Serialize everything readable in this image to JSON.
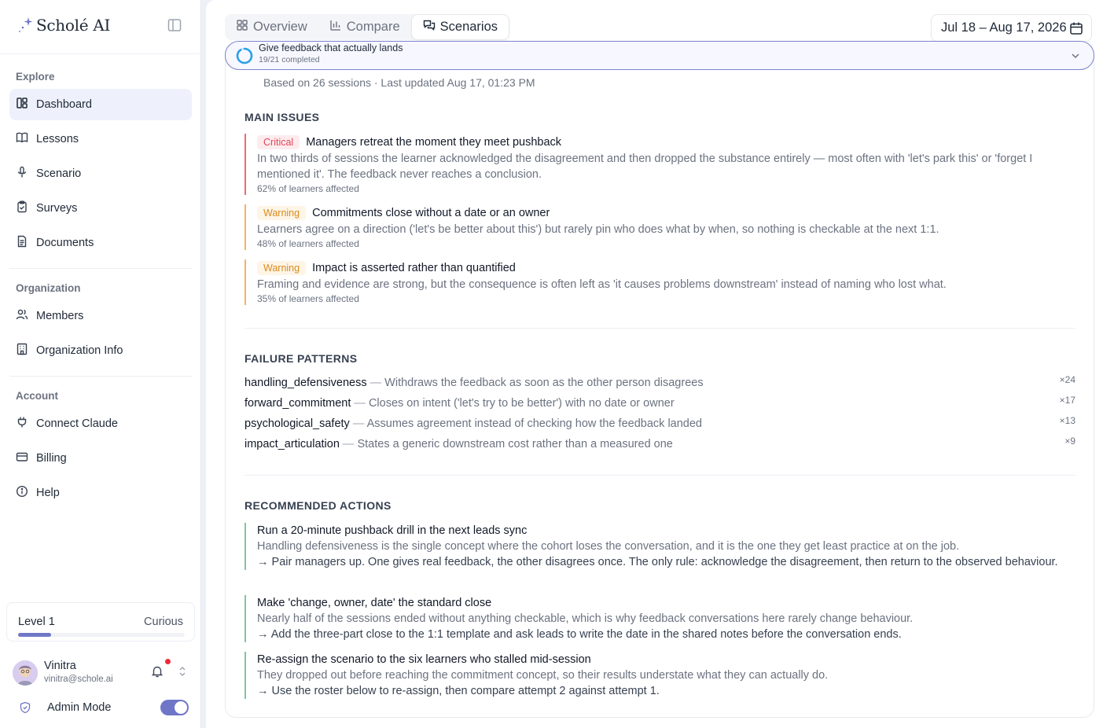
{
  "brand": {
    "name": "Scholé AI"
  },
  "sidebar": {
    "sections": {
      "explore": "Explore",
      "organization": "Organization",
      "account": "Account"
    },
    "items": {
      "dashboard": "Dashboard",
      "lessons": "Lessons",
      "scenario": "Scenario",
      "surveys": "Surveys",
      "documents": "Documents",
      "members": "Members",
      "org_info": "Organization Info",
      "connect_claude": "Connect Claude",
      "billing": "Billing",
      "help": "Help"
    },
    "active_item": "dashboard",
    "level": {
      "name": "Level 1",
      "rank": "Curious",
      "progress": 0.2
    },
    "user": {
      "name": "Vinitra",
      "email": "vinitra@schole.ai",
      "has_notification": true
    },
    "admin": {
      "label": "Admin Mode",
      "enabled": true
    }
  },
  "header": {
    "tabs": [
      {
        "label": "Overview",
        "icon": "grid-icon"
      },
      {
        "label": "Compare",
        "icon": "bar-chart-icon"
      },
      {
        "label": "Scenarios",
        "icon": "chat-icon"
      }
    ],
    "active_tab": "Scenarios",
    "date_range": "Jul 18 – Aug 17, 2026"
  },
  "progress": {
    "title": "Give feedback that actually lands",
    "subtitle": "19/21 completed",
    "completed": 19,
    "total": 21
  },
  "report": {
    "meta": "Based on 26 sessions · Last updated Aug 17, 01:23 PM",
    "main_issues": {
      "title": "MAIN ISSUES",
      "items": [
        {
          "severity": "Critical",
          "title": "Managers retreat the moment they meet pushback",
          "description": "In two thirds of sessions the learner acknowledged the disagreement and then dropped the substance entirely — most often with 'let's park this' or 'forget I mentioned it'. The feedback never reaches a conclusion.",
          "affected": "62% of learners affected"
        },
        {
          "severity": "Warning",
          "title": "Commitments close without a date or an owner",
          "description": "Learners agree on a direction ('let's be better about this') but rarely pin who does what by when, so nothing is checkable at the next 1:1.",
          "affected": "48% of learners affected"
        },
        {
          "severity": "Warning",
          "title": "Impact is asserted rather than quantified",
          "description": "Framing and evidence are strong, but the consequence is often left as 'it causes problems downstream' instead of naming who lost what.",
          "affected": "35% of learners affected"
        }
      ]
    },
    "failure_patterns": {
      "title": "FAILURE PATTERNS",
      "items": [
        {
          "code": "handling_defensiveness",
          "description": "Withdraws the feedback as soon as the other person disagrees",
          "count": "×24"
        },
        {
          "code": "forward_commitment",
          "description": "Closes on intent ('let's try to be better') with no date or owner",
          "count": "×17"
        },
        {
          "code": "psychological_safety",
          "description": "Assumes agreement instead of checking how the feedback landed",
          "count": "×13"
        },
        {
          "code": "impact_articulation",
          "description": "States a generic downstream cost rather than a measured one",
          "count": "×9"
        }
      ]
    },
    "recommended_actions": {
      "title": "RECOMMENDED ACTIONS",
      "items": [
        {
          "title": "Run a 20-minute pushback drill in the next leads sync",
          "description": "Handling defensiveness is the single concept where the cohort loses the conversation, and it is the one they get least practice at on the job.",
          "step": "→ Pair managers up. One gives real feedback, the other disagrees once. The only rule: acknowledge the disagreement, then return to the observed behaviour."
        },
        {
          "title": "Make 'change, owner, date' the standard close",
          "description": "Nearly half of the sessions ended without anything checkable, which is why feedback conversations here rarely change behaviour.",
          "step": "→ Add the three-part close to the 1:1 template and ask leads to write the date in the shared notes before the conversation ends."
        },
        {
          "title": "Re-assign the scenario to the six learners who stalled mid-session",
          "description": "They dropped out before reaching the commitment concept, so their results understate what they can actually do.",
          "step": "→ Use the roster below to re-assign, then compare attempt 2 against attempt 1."
        }
      ]
    }
  },
  "colors": {
    "accent": "#7077c7",
    "critical": "#e2465a",
    "warning": "#d98a1d",
    "action": "#7fc89a"
  }
}
